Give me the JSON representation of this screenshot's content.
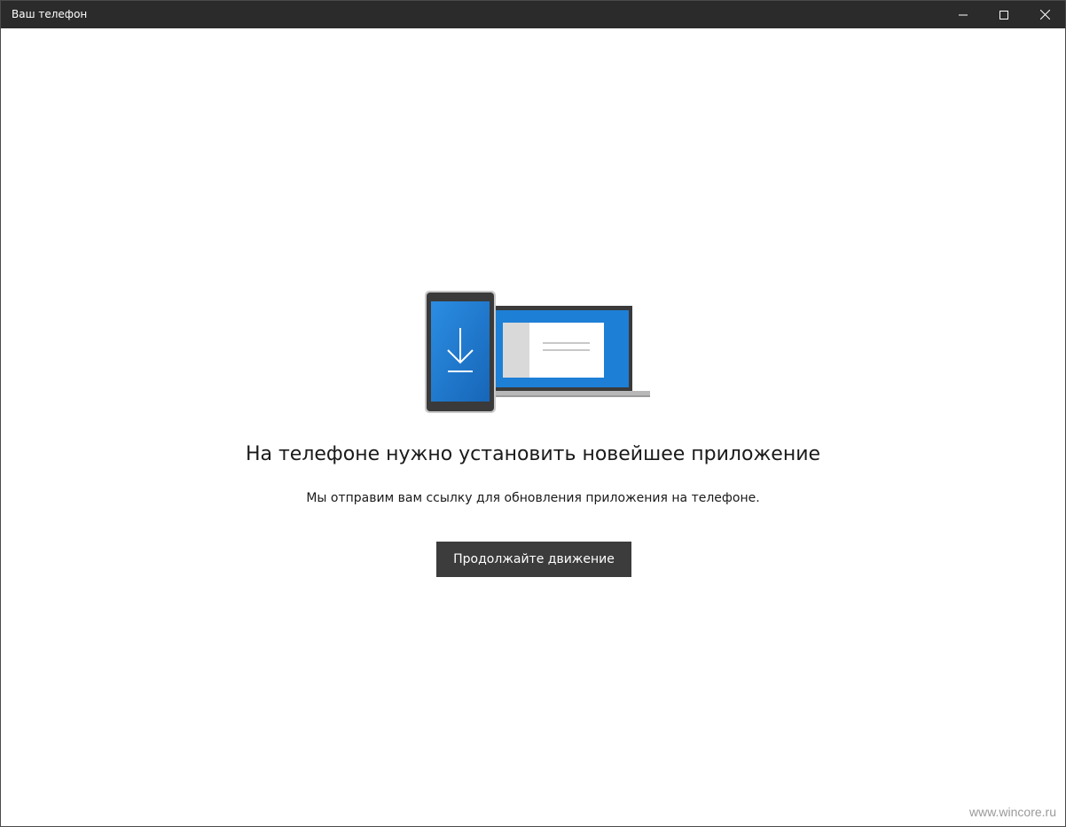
{
  "window": {
    "title": "Ваш телефон"
  },
  "main": {
    "heading": "На телефоне нужно установить новейшее приложение",
    "subtext": "Мы отправим вам ссылку для обновления приложения на телефоне.",
    "continue_label": "Продолжайте движение"
  },
  "watermark": "www.wincore.ru",
  "illustration": {
    "icon": "phone-download-laptop-icon",
    "accent_color": "#1e7fd6",
    "frame_color": "#3a3a3a"
  },
  "colors": {
    "titlebar": "#2b2b2b",
    "button": "#3c3c3c"
  }
}
